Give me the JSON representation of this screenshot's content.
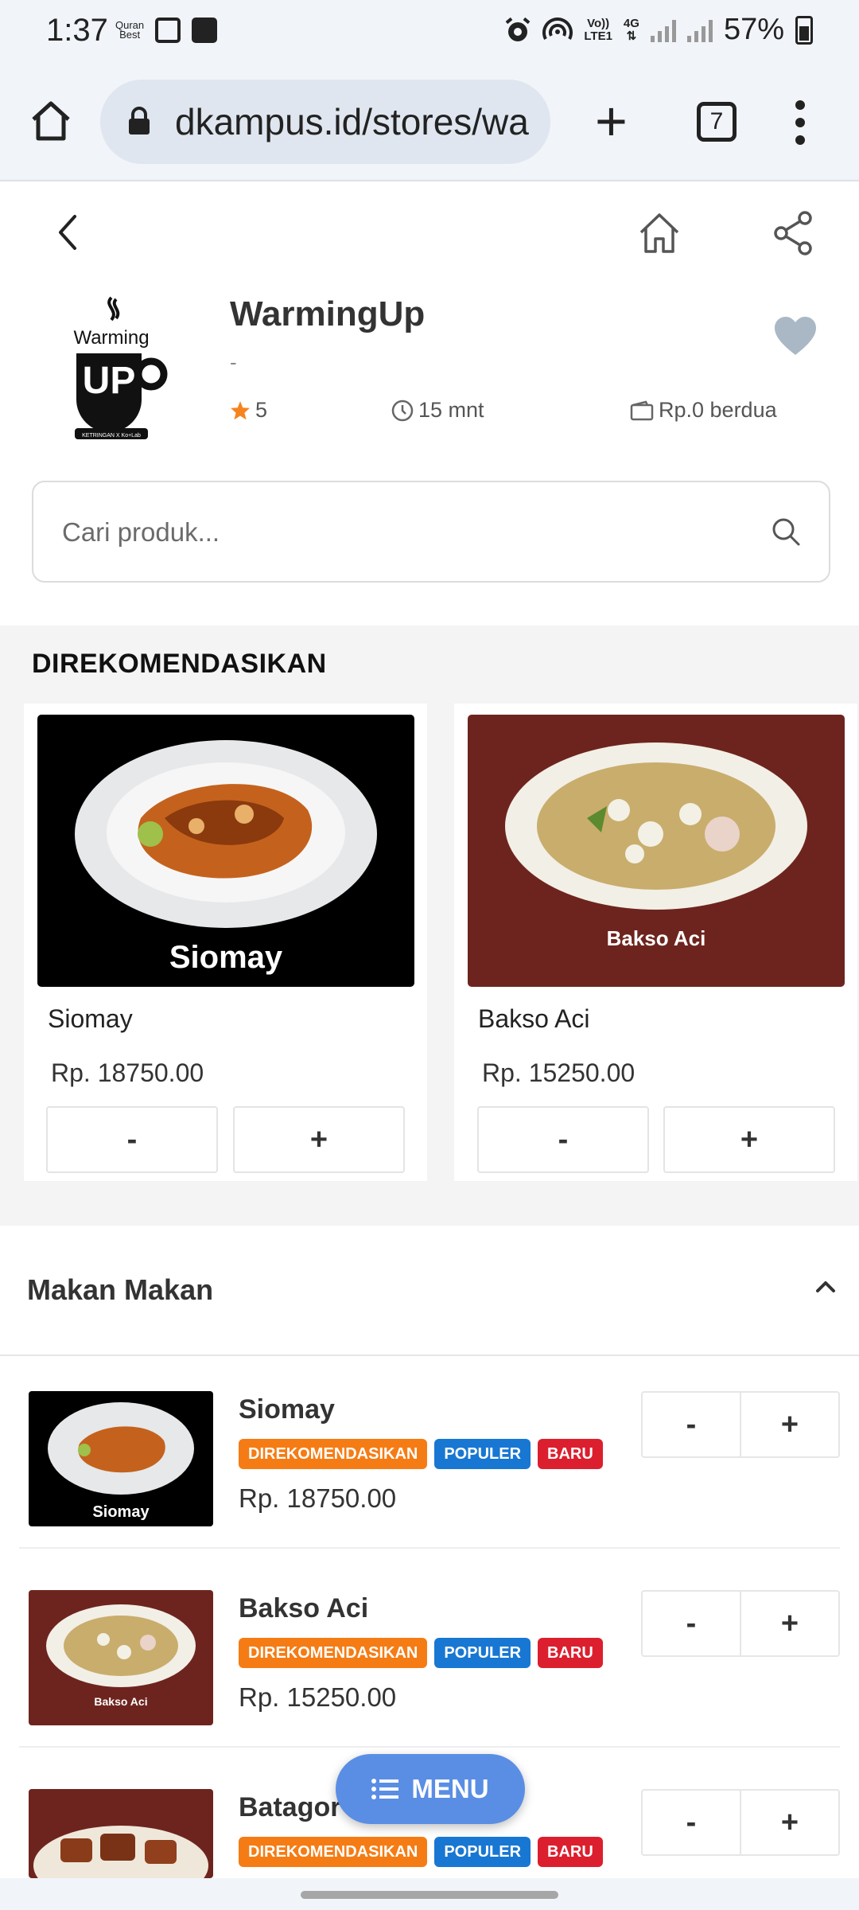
{
  "status_bar": {
    "time": "1:37",
    "app_label_top": "Quran",
    "app_label_bottom": "Best",
    "volte_top": "Vo))",
    "volte_bottom": "LTE1",
    "network": "4G",
    "battery": "57%"
  },
  "browser": {
    "url": "dkampus.id/stores/wa",
    "tab_count": "7"
  },
  "store": {
    "name": "WarmingUp",
    "description": "-",
    "rating": "5",
    "delivery_time": "15 mnt",
    "delivery_fee": "Rp.0 berdua",
    "logo_text_top": "Warming",
    "logo_text_big": "UP",
    "logo_caption": "KETRINGAN X Ko+Lab"
  },
  "search": {
    "placeholder": "Cari produk..."
  },
  "recommended": {
    "title": "DIREKOMENDASIKAN",
    "items": [
      {
        "name": "Siomay",
        "price": "Rp. 18750.00",
        "image_caption": "Siomay",
        "minus": "-",
        "plus": "+"
      },
      {
        "name": "Bakso Aci",
        "price": "Rp. 15250.00",
        "image_caption": "Bakso Aci",
        "minus": "-",
        "plus": "+"
      }
    ]
  },
  "category": {
    "title": "Makan Makan",
    "items": [
      {
        "name": "Siomay",
        "price": "Rp. 18750.00",
        "image_caption": "Siomay",
        "tags": [
          "DIREKOMENDASIKAN",
          "POPULER",
          "BARU"
        ],
        "minus": "-",
        "plus": "+"
      },
      {
        "name": "Bakso Aci",
        "price": "Rp. 15250.00",
        "image_caption": "Bakso Aci",
        "tags": [
          "DIREKOMENDASIKAN",
          "POPULER",
          "BARU"
        ],
        "minus": "-",
        "plus": "+"
      },
      {
        "name": "Batagor",
        "tags": [
          "DIREKOMENDASIKAN",
          "POPULER",
          "BARU"
        ],
        "minus": "-",
        "plus": "+"
      }
    ]
  },
  "menu_button": {
    "label": "MENU"
  },
  "colors": {
    "accent_menu": "#5a8ee4",
    "tag_recommended": "#f57c14",
    "tag_popular": "#1877d2",
    "tag_new": "#dc1f2e",
    "star": "#f5841f",
    "heart": "#a9b8c4"
  },
  "icons": {
    "status_left": [
      "quran-app-icon",
      "gallery-icon",
      "storage-icon"
    ],
    "status_right": [
      "alarm-icon",
      "hotspot-icon",
      "volte-icon",
      "signal-icon",
      "signal-icon",
      "battery-icon"
    ],
    "toolbar": [
      "home-icon",
      "lock-icon",
      "new-tab-icon",
      "tabs-icon",
      "more-vert-icon"
    ],
    "page": [
      "back-arrow-icon",
      "home-icon",
      "share-icon",
      "heart-icon",
      "star-icon",
      "clock-icon",
      "wallet-icon",
      "search-icon",
      "chevron-up-icon",
      "list-icon"
    ]
  }
}
